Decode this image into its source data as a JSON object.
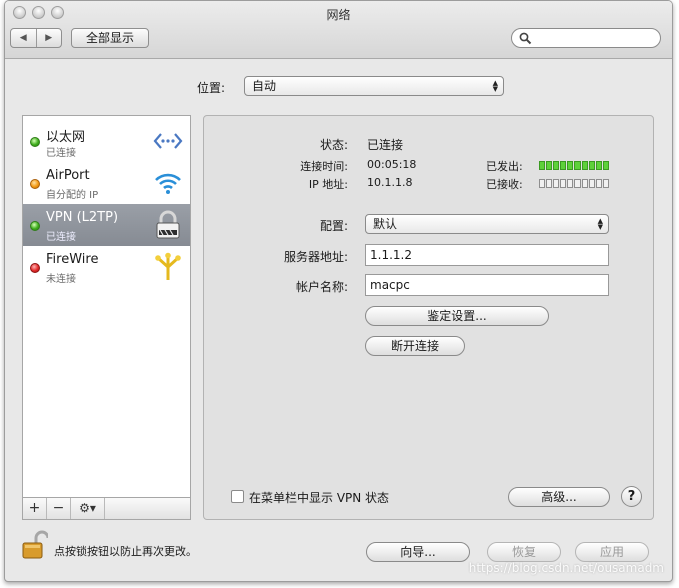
{
  "window": {
    "title": "网络"
  },
  "toolbar": {
    "show_all_label": "全部显示",
    "back_label": "◀",
    "forward_label": "▶"
  },
  "location": {
    "label": "位置:",
    "value": "自动"
  },
  "services": [
    {
      "name": "以太网",
      "status": "已连接",
      "dot": "green",
      "icon": "ethernet-icon"
    },
    {
      "name": "AirPort",
      "status": "自分配的 IP",
      "dot": "orange",
      "icon": "wifi-icon"
    },
    {
      "name": "VPN (L2TP)",
      "status": "已连接",
      "dot": "green",
      "icon": "vpn-lock-icon",
      "selected": true
    },
    {
      "name": "FireWire",
      "status": "未连接",
      "dot": "red",
      "icon": "firewire-icon"
    }
  ],
  "sidebar_bar": {
    "add": "+",
    "remove": "−",
    "gear": "⚙▾"
  },
  "detail": {
    "status_label": "状态:",
    "status_value": "已连接",
    "connect_time_label": "连接时间:",
    "connect_time_value": "00:05:18",
    "ip_label": "IP 地址:",
    "ip_value": "10.1.1.8",
    "sent_label": "已发出:",
    "received_label": "已接收:",
    "config_label": "配置:",
    "config_value": "默认",
    "server_label": "服务器地址:",
    "server_value": "1.1.1.2",
    "account_label": "帐户名称:",
    "account_value": "macpc",
    "auth_button": "鉴定设置...",
    "disconnect_button": "断开连接",
    "show_vpn_checkbox_label": "在菜单栏中显示 VPN 状态",
    "show_vpn_checked": false,
    "advanced_button": "高级...",
    "help_button": "?"
  },
  "footer": {
    "lock_text": "点按锁按钮以防止再次更改。",
    "assist_button": "向导...",
    "revert_button": "恢复",
    "apply_button": "应用"
  },
  "watermark": "https://blog.csdn.net/ousamadm",
  "colors": {
    "selection": "#8e939b",
    "meter_on": "#5dd13a"
  }
}
